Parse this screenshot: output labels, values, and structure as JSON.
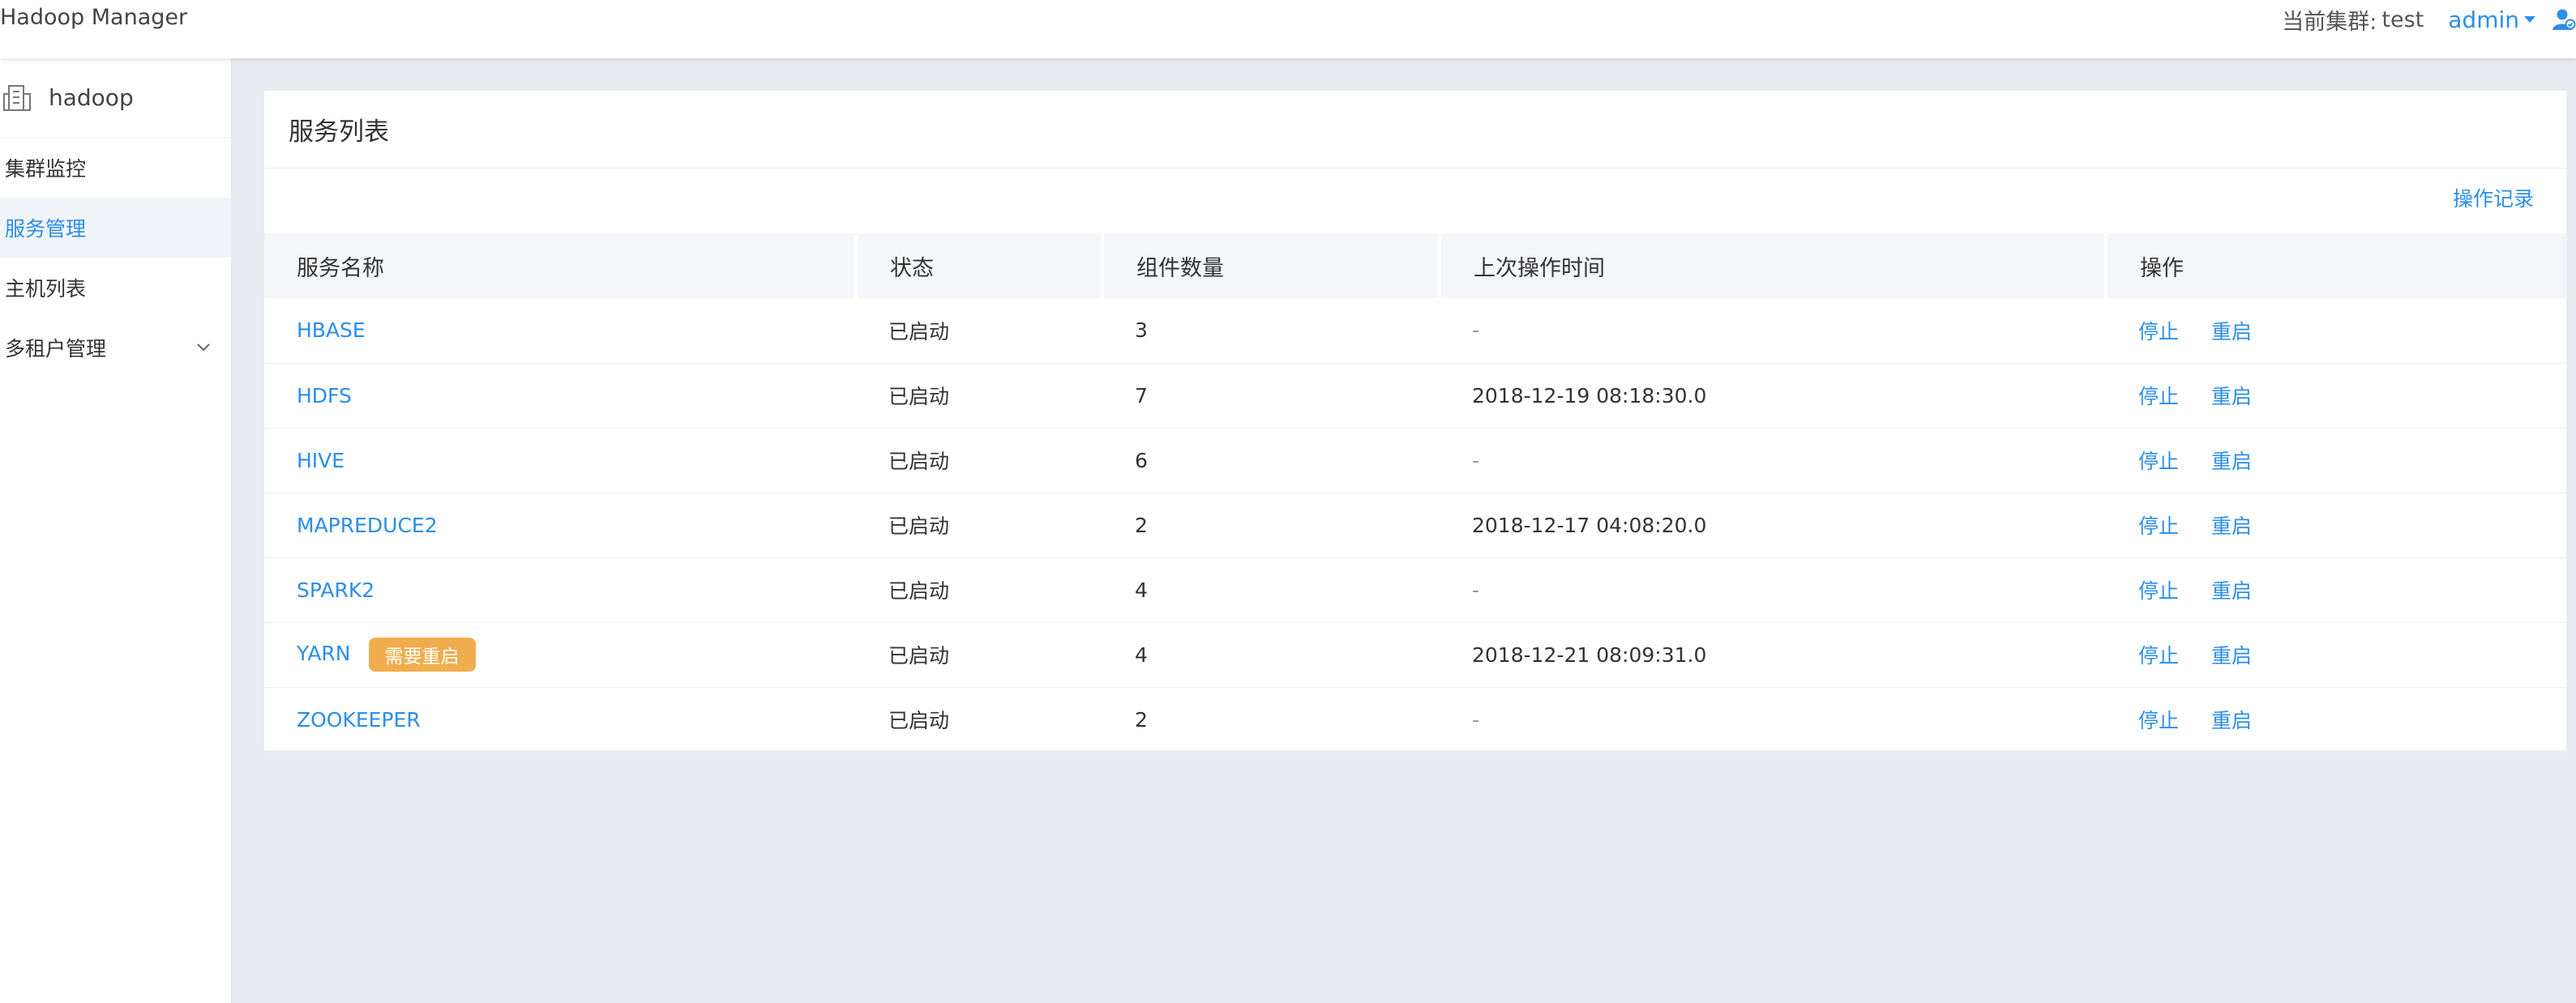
{
  "header": {
    "title": "Hadoop Manager",
    "cluster_label": "当前集群:",
    "cluster_name": "test",
    "user": "admin",
    "user_icon": "user-icon",
    "accent": "#2b8ee8"
  },
  "sidebar": {
    "cluster": "hadoop",
    "cluster_icon": "building-icon",
    "items": [
      {
        "label": "集群监控"
      },
      {
        "label": "服务管理",
        "active": true
      },
      {
        "label": "主机列表"
      },
      {
        "label": "多租户管理",
        "expandable": true
      }
    ]
  },
  "panel": {
    "title": "服务列表",
    "oplog_label": "操作记录",
    "columns": [
      "服务名称",
      "状态",
      "组件数量",
      "上次操作时间",
      "操作"
    ],
    "action_labels": {
      "stop": "停止",
      "restart": "重启"
    },
    "badge_color": "#f0ad4e",
    "rows": [
      {
        "name": "HBASE",
        "status": "已启动",
        "components": "3",
        "last_op": "-",
        "badge": ""
      },
      {
        "name": "HDFS",
        "status": "已启动",
        "components": "7",
        "last_op": "2018-12-19 08:18:30.0",
        "badge": ""
      },
      {
        "name": "HIVE",
        "status": "已启动",
        "components": "6",
        "last_op": "-",
        "badge": ""
      },
      {
        "name": "MAPREDUCE2",
        "status": "已启动",
        "components": "2",
        "last_op": "2018-12-17 04:08:20.0",
        "badge": ""
      },
      {
        "name": "SPARK2",
        "status": "已启动",
        "components": "4",
        "last_op": "-",
        "badge": ""
      },
      {
        "name": "YARN",
        "status": "已启动",
        "components": "4",
        "last_op": "2018-12-21 08:09:31.0",
        "badge": "需要重启"
      },
      {
        "name": "ZOOKEEPER",
        "status": "已启动",
        "components": "2",
        "last_op": "-",
        "badge": ""
      }
    ]
  }
}
